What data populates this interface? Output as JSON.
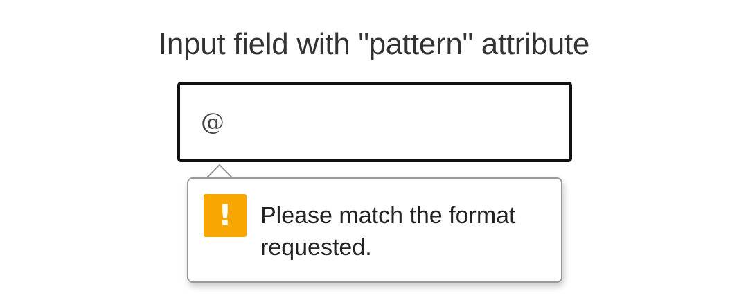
{
  "page": {
    "title": "Input field with \"pattern\" attribute"
  },
  "input": {
    "value": "@",
    "border_color": "#111111"
  },
  "validation_tooltip": {
    "icon": "warning-exclamation-icon",
    "icon_glyph": "!",
    "icon_color": "#f7a700",
    "message": "Please match the format requested."
  }
}
